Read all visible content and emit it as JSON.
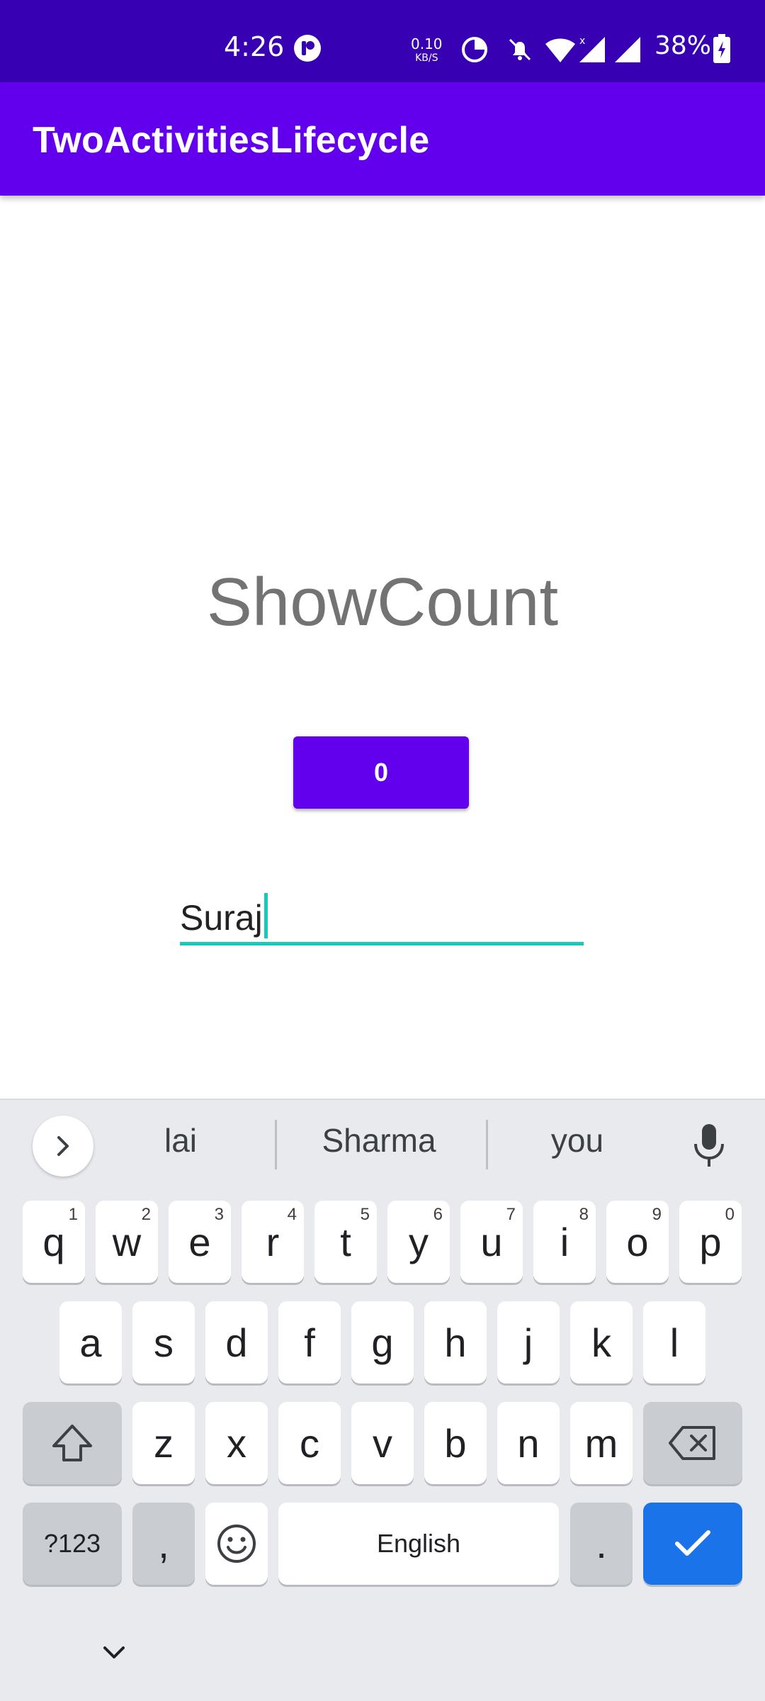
{
  "status_bar": {
    "time": "4:26",
    "net_speed_value": "0.10",
    "net_speed_unit": "KB/S",
    "battery": "38%"
  },
  "app_bar": {
    "title": "TwoActivitiesLifecycle"
  },
  "main": {
    "heading": "ShowCount",
    "count_button_label": "0",
    "name_input_value": "Suraj"
  },
  "keyboard": {
    "suggestions": [
      "lai",
      "Sharma",
      "you"
    ],
    "row1": [
      {
        "k": "q",
        "h": "1"
      },
      {
        "k": "w",
        "h": "2"
      },
      {
        "k": "e",
        "h": "3"
      },
      {
        "k": "r",
        "h": "4"
      },
      {
        "k": "t",
        "h": "5"
      },
      {
        "k": "y",
        "h": "6"
      },
      {
        "k": "u",
        "h": "7"
      },
      {
        "k": "i",
        "h": "8"
      },
      {
        "k": "o",
        "h": "9"
      },
      {
        "k": "p",
        "h": "0"
      }
    ],
    "row2": [
      "a",
      "s",
      "d",
      "f",
      "g",
      "h",
      "j",
      "k",
      "l"
    ],
    "row3": [
      "z",
      "x",
      "c",
      "v",
      "b",
      "n",
      "m"
    ],
    "symbols_label": "?123",
    "comma_label": ",",
    "space_label": "English",
    "period_label": "."
  },
  "colors": {
    "status_bar": "#3700b3",
    "app_bar": "#6200ee",
    "accent": "#18c8b8",
    "enter_key": "#1a73e8"
  }
}
